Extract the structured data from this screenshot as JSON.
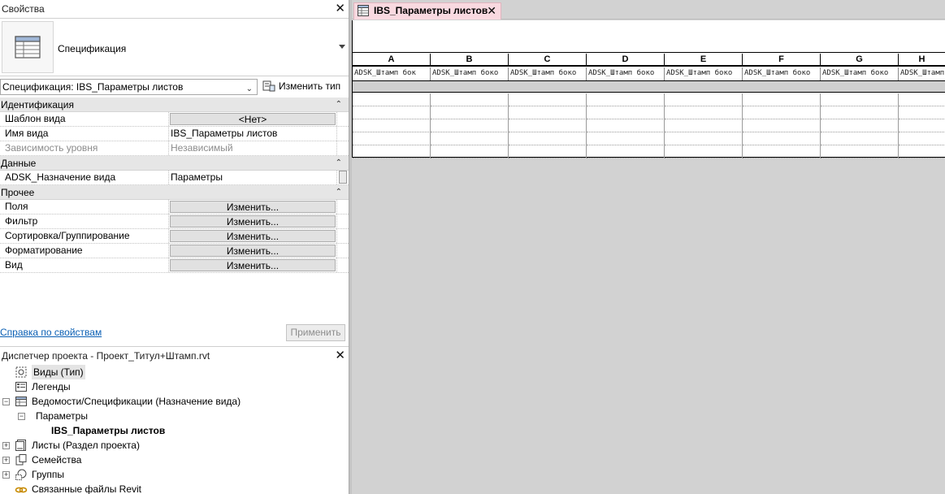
{
  "properties_panel": {
    "title": "Свойства",
    "close": "✕",
    "type_name": "Спецификация",
    "instance_selector": "Спецификация: IBS_Параметры листов",
    "edit_type_label": "Изменить тип",
    "categories": [
      {
        "label": "Идентификация",
        "toggle": "⌃",
        "rows": [
          {
            "name": "Шаблон вида",
            "value": "<Нет>",
            "kind": "button"
          },
          {
            "name": "Имя вида",
            "value": "IBS_Параметры листов",
            "kind": "text"
          },
          {
            "name": "Зависимость уровня",
            "value": "Независимый",
            "kind": "disabled"
          }
        ]
      },
      {
        "label": "Данные",
        "toggle": "⌃",
        "rows": [
          {
            "name": "ADSK_Назначение вида",
            "value": "Параметры",
            "kind": "text"
          }
        ]
      },
      {
        "label": "Прочее",
        "toggle": "⌃",
        "rows": [
          {
            "name": "Поля",
            "value": "Изменить...",
            "kind": "button"
          },
          {
            "name": "Фильтр",
            "value": "Изменить...",
            "kind": "button"
          },
          {
            "name": "Сортировка/Группирование",
            "value": "Изменить...",
            "kind": "button"
          },
          {
            "name": "Форматирование",
            "value": "Изменить...",
            "kind": "button"
          },
          {
            "name": "Вид",
            "value": "Изменить...",
            "kind": "button"
          }
        ]
      }
    ],
    "help_link": "Справка по свойствам",
    "apply_label": "Применить"
  },
  "project_browser": {
    "title": "Диспетчер проекта - Проект_Титул+Штамп.rvt",
    "close": "✕",
    "nodes": [
      {
        "label": "Виды (Тип)",
        "expander": "",
        "icon": "views-icon",
        "indent": 0,
        "selected": true
      },
      {
        "label": "Легенды",
        "expander": "",
        "icon": "legend-icon",
        "indent": 0,
        "selected": false
      },
      {
        "label": "Ведомости/Спецификации (Назначение вида)",
        "expander": "−",
        "icon": "schedule-icon",
        "indent": 0,
        "selected": false
      },
      {
        "label": "Параметры",
        "expander": "−",
        "icon": "",
        "indent": 1,
        "selected": false
      },
      {
        "label": "IBS_Параметры листов",
        "expander": "",
        "icon": "",
        "indent": 2,
        "selected": false,
        "bold": true
      },
      {
        "label": "Листы (Раздел проекта)",
        "expander": "+",
        "icon": "sheets-icon",
        "indent": 0,
        "selected": false
      },
      {
        "label": "Семейства",
        "expander": "+",
        "icon": "families-icon",
        "indent": 0,
        "selected": false
      },
      {
        "label": "Группы",
        "expander": "+",
        "icon": "groups-icon",
        "indent": 0,
        "selected": false
      },
      {
        "label": "Связанные файлы Revit",
        "expander": "",
        "icon": "links-icon",
        "indent": 0,
        "selected": false
      }
    ]
  },
  "view_tab": {
    "label": "IBS_Параметры листов",
    "close": "✕"
  },
  "schedule": {
    "columns": [
      "A",
      "B",
      "C",
      "D",
      "E",
      "F",
      "G",
      "H"
    ],
    "field_headers": [
      "ADSK_Штамп бок",
      "ADSK_Штамп боко",
      "ADSK_Штамп боко",
      "ADSK_Штамп боко",
      "ADSK_Штамп боко",
      "ADSK_Штамп боко",
      "ADSK_Штамп боко",
      "ADSK_Штамп боко"
    ],
    "data_row_count": 5
  }
}
